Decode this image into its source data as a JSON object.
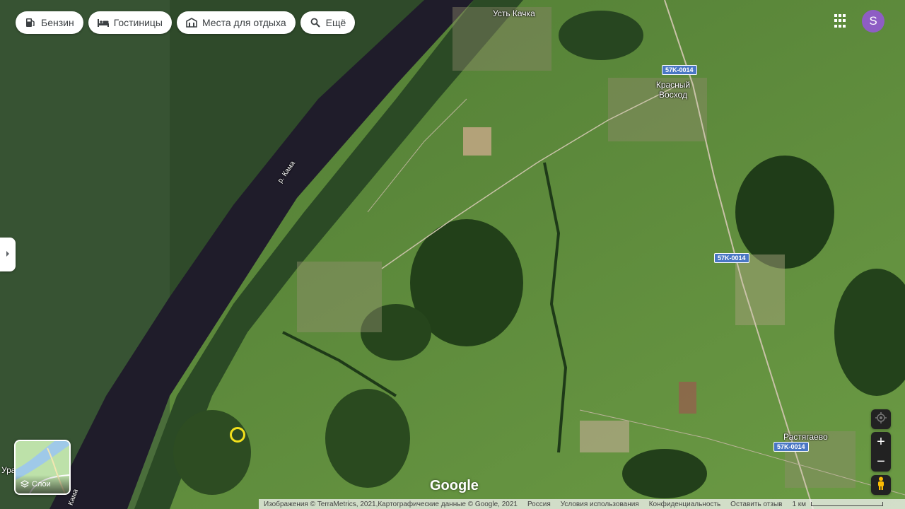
{
  "chips": [
    {
      "icon": "gas-station-icon",
      "label": "Бензин"
    },
    {
      "icon": "bed-icon",
      "label": "Гостиницы"
    },
    {
      "icon": "attraction-icon",
      "label": "Места для отдыха"
    },
    {
      "icon": "search-icon",
      "label": "Ещё"
    }
  ],
  "account": {
    "initial": "S",
    "color": "#8e5dc4"
  },
  "map_labels": {
    "ust_kachka": "Усть Качка",
    "krasny_voskhod": "Красный Восход",
    "river": "р. Кама",
    "rastyagaevo": "Растягаево",
    "ura": "Ура",
    "kama_bottom": "Кама"
  },
  "road_shields": {
    "a": "57K-0014",
    "b": "57K-0014",
    "c": "57K-0014"
  },
  "layers": {
    "label": "Слои"
  },
  "zoom": {
    "in": "+",
    "out": "−"
  },
  "logo": "Google",
  "footer": {
    "imagery": "Изображения © TerraMetrics, 2021,Картографические данные © Google, 2021",
    "country": "Россия",
    "terms": "Условия использования",
    "privacy": "Конфиденциальность",
    "feedback": "Оставить отзыв",
    "scale": "1 км"
  },
  "colors": {
    "river": "#1f1c2a",
    "forest": "#2e4a22",
    "field": "#5f8a3a",
    "marker": "#f2e01c",
    "shield": "#4a77c4"
  }
}
